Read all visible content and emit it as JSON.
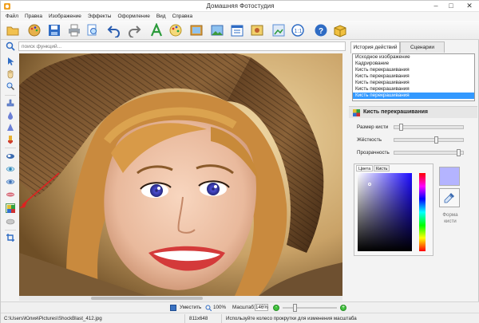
{
  "window": {
    "title": "Домашняя Фотостудия"
  },
  "menu": [
    "Файл",
    "Правка",
    "Изображение",
    "Эффекты",
    "Оформление",
    "Вид",
    "Справка"
  ],
  "search": {
    "placeholder": "поиск функций..."
  },
  "right_panel": {
    "tabs": [
      "История действий",
      "Сценарии"
    ],
    "history": [
      "Исходное изображение",
      "Кадрирование",
      "Кисть перекрашивания",
      "Кисть перекрашивания",
      "Кисть перекрашивания",
      "Кисть перекрашивания",
      "Кисть перекрашивания"
    ],
    "history_selected_index": 6,
    "tool_title": "Кисть перекрашивания",
    "sliders": [
      {
        "label": "Размер кисти",
        "value": 0.08
      },
      {
        "label": "Жёсткость",
        "value": 0.62
      },
      {
        "label": "Прозрачность",
        "value": 0.98
      }
    ],
    "color_tabs": [
      "Цвета",
      "Кисть"
    ],
    "current_color": "#b4b4ff",
    "brush_shape_label": "Форма кисти"
  },
  "zoom": {
    "fit_label": "Уместить",
    "z100_label": "100%",
    "scale_label": "Масштаб:",
    "value": "146%"
  },
  "status": {
    "path": "C:\\Users\\Юлия\\Pictures\\ShockBlast_412.jpg",
    "dimensions": "811x648",
    "hint": "Используйте колесо прокрутки для изменения масштаба"
  }
}
